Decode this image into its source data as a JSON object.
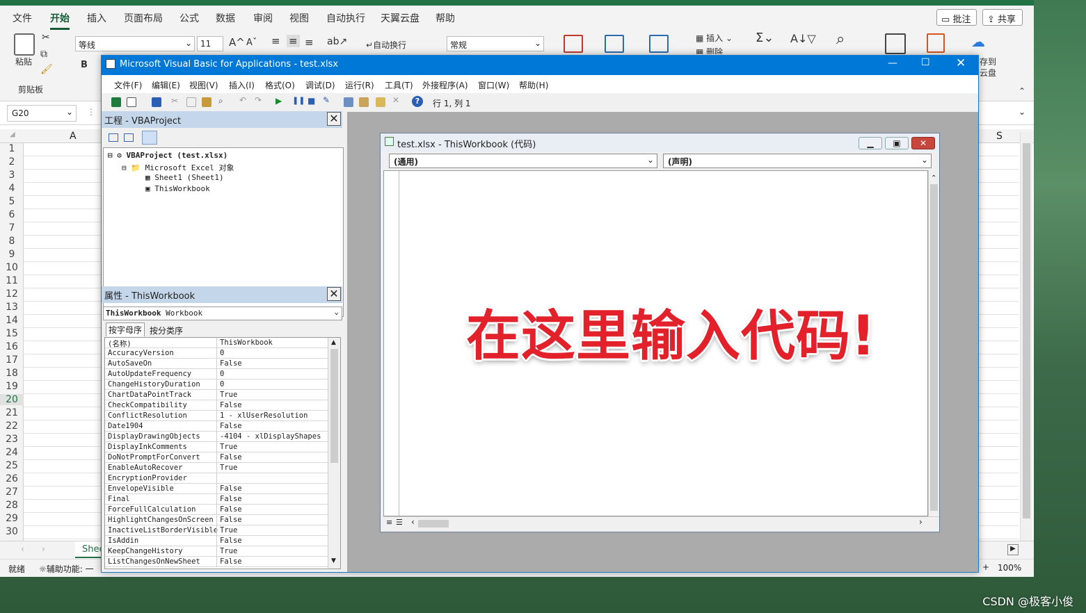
{
  "excel": {
    "tabs": [
      "文件",
      "开始",
      "插入",
      "页面布局",
      "公式",
      "数据",
      "审阅",
      "视图",
      "自动执行",
      "天翼云盘",
      "帮助"
    ],
    "active_tab": "开始",
    "comment_btn": "批注",
    "share_btn": "共享",
    "paste_label": "粘贴",
    "clipboard_group": "剪贴板",
    "font_name": "等线",
    "font_size": "11",
    "wrap_text": "自动换行",
    "number_format": "常规",
    "insert_label": "插入",
    "delete_label": "删除",
    "cloud_label_1": "存到",
    "cloud_label_2": "云盘",
    "name_box": "G20",
    "col_a": "A",
    "col_s": "S",
    "rows": [
      "1",
      "2",
      "3",
      "4",
      "5",
      "6",
      "7",
      "8",
      "9",
      "10",
      "11",
      "12",
      "13",
      "14",
      "15",
      "16",
      "17",
      "18",
      "19",
      "20",
      "21",
      "22",
      "23",
      "24",
      "25",
      "26",
      "27",
      "28",
      "29",
      "30"
    ],
    "selected_row": "20",
    "sheet_tab": "Shee",
    "status_ready": "就绪",
    "accessibility": "辅助功能: 一",
    "zoom": "100%"
  },
  "vbe": {
    "title": "Microsoft Visual Basic for Applications - test.xlsx",
    "menu": [
      "文件(F)",
      "编辑(E)",
      "视图(V)",
      "插入(I)",
      "格式(O)",
      "调试(D)",
      "运行(R)",
      "工具(T)",
      "外接程序(A)",
      "窗口(W)",
      "帮助(H)"
    ],
    "position": "行 1, 列 1",
    "project_pane_title": "工程 - VBAProject",
    "tree": [
      "VBAProject (test.xlsx)",
      "Microsoft Excel 对象",
      "Sheet1 (Sheet1)",
      "ThisWorkbook"
    ],
    "props_pane_title": "属性 - ThisWorkbook",
    "props_object_bold": "ThisWorkbook",
    "props_object_type": "Workbook",
    "props_tab_alpha": "按字母序",
    "props_tab_cat": "按分类序",
    "properties": [
      {
        "name": "(名称)",
        "value": "ThisWorkbook"
      },
      {
        "name": "AccuracyVersion",
        "value": "0"
      },
      {
        "name": "AutoSaveOn",
        "value": "False"
      },
      {
        "name": "AutoUpdateFrequency",
        "value": "0"
      },
      {
        "name": "ChangeHistoryDuration",
        "value": "0"
      },
      {
        "name": "ChartDataPointTrack",
        "value": "True"
      },
      {
        "name": "CheckCompatibility",
        "value": "False"
      },
      {
        "name": "ConflictResolution",
        "value": "1 - xlUserResolution"
      },
      {
        "name": "Date1904",
        "value": "False"
      },
      {
        "name": "DisplayDrawingObjects",
        "value": "-4104 - xlDisplayShapes"
      },
      {
        "name": "DisplayInkComments",
        "value": "True"
      },
      {
        "name": "DoNotPromptForConvert",
        "value": "False"
      },
      {
        "name": "EnableAutoRecover",
        "value": "True"
      },
      {
        "name": "EncryptionProvider",
        "value": ""
      },
      {
        "name": "EnvelopeVisible",
        "value": "False"
      },
      {
        "name": "Final",
        "value": "False"
      },
      {
        "name": "ForceFullCalculation",
        "value": "False"
      },
      {
        "name": "HighlightChangesOnScreen",
        "value": "False"
      },
      {
        "name": "InactiveListBorderVisible",
        "value": "True"
      },
      {
        "name": "IsAddin",
        "value": "False"
      },
      {
        "name": "KeepChangeHistory",
        "value": "True"
      },
      {
        "name": "ListChangesOnNewSheet",
        "value": "False"
      }
    ],
    "code_title": "test.xlsx - ThisWorkbook (代码)",
    "object_dd": "(通用)",
    "proc_dd": "(声明)",
    "overlay_text": "在这里输入代码!"
  },
  "watermark": "CSDN @极客小俊"
}
